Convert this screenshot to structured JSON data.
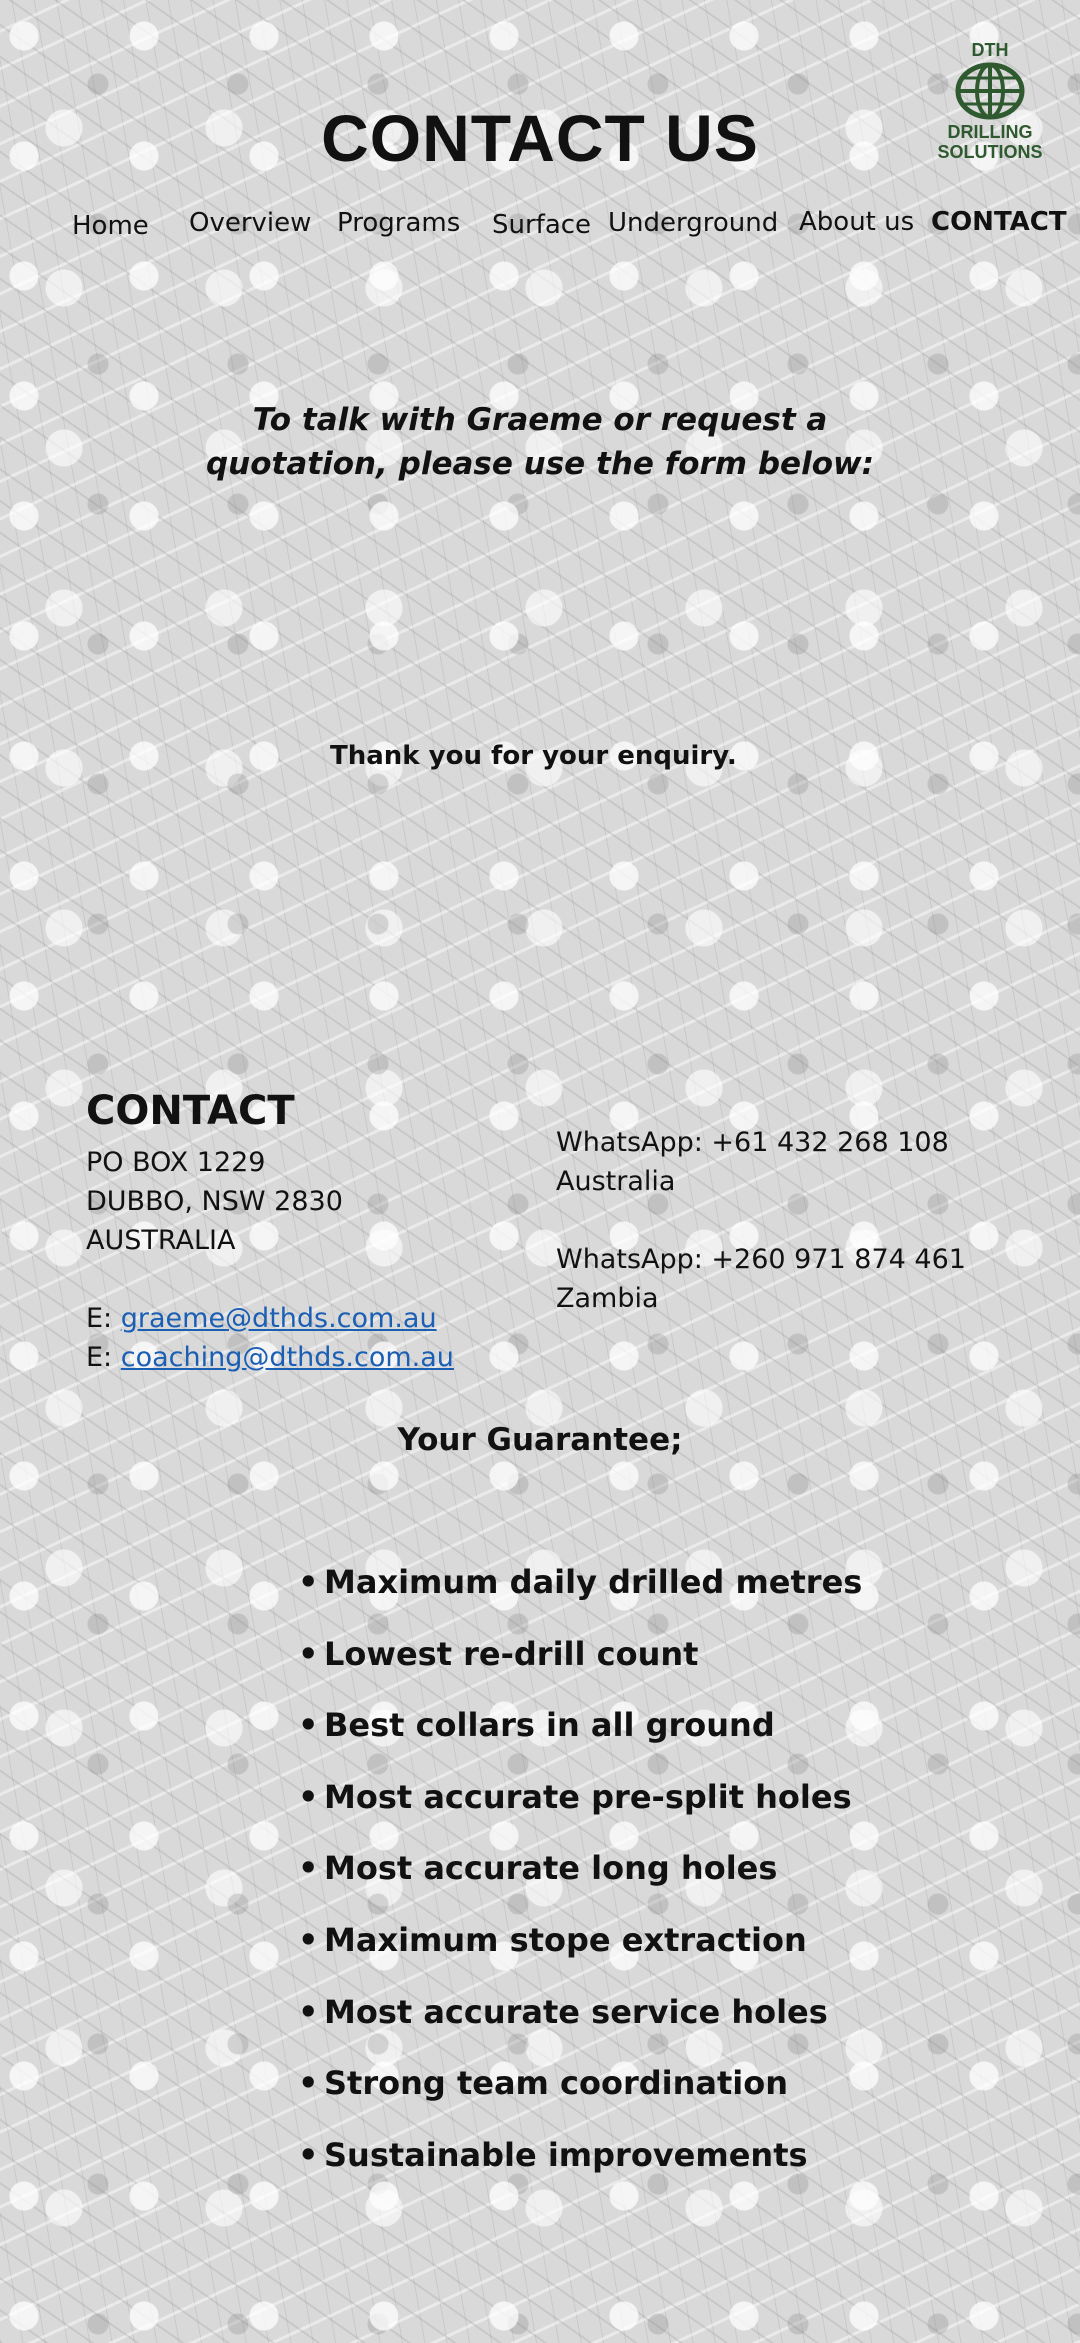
{
  "header": {
    "title": "CONTACT US",
    "logo": {
      "line1": "DTH",
      "line2": "DRILLING",
      "line3": "SOLUTIONS",
      "icon": "globe-icon",
      "color": "#2f5a2f"
    }
  },
  "nav": [
    {
      "label": "Home"
    },
    {
      "label": "Overview"
    },
    {
      "label": "Programs"
    },
    {
      "label": "Surface"
    },
    {
      "label": "Underground"
    },
    {
      "label": "About us"
    },
    {
      "label": "CONTACT",
      "active": true
    }
  ],
  "intro": {
    "line1": "To talk with Graeme or request a",
    "line2": "quotation, please use the form below:"
  },
  "form": {
    "thank_you": "Thank you for your enquiry."
  },
  "contact": {
    "heading": "CONTACT",
    "address": [
      "PO BOX 1229",
      "DUBBO, NSW 2830",
      "AUSTRALIA"
    ],
    "emails": [
      {
        "prefix": "E:",
        "address": "graeme@dthds.com.au"
      },
      {
        "prefix": "E:",
        "address": "coaching@dthds.com.au"
      }
    ],
    "whatsapp": [
      {
        "number": "WhatsApp: +61 432 268 108",
        "country": "Australia"
      },
      {
        "number": "WhatsApp: +260 971 874 461",
        "country": "Zambia"
      }
    ],
    "link_color": "#1a5fb4"
  },
  "guarantee": {
    "title": "Your Guarantee;",
    "bullet": "•",
    "items": [
      "Maximum daily drilled metres",
      "Lowest re-drill count",
      "Best collars in all ground",
      "Most accurate pre-split holes",
      "Most accurate long holes",
      "Maximum stope extraction",
      "Most accurate service holes",
      "Strong team coordination",
      "Sustainable improvements"
    ]
  }
}
